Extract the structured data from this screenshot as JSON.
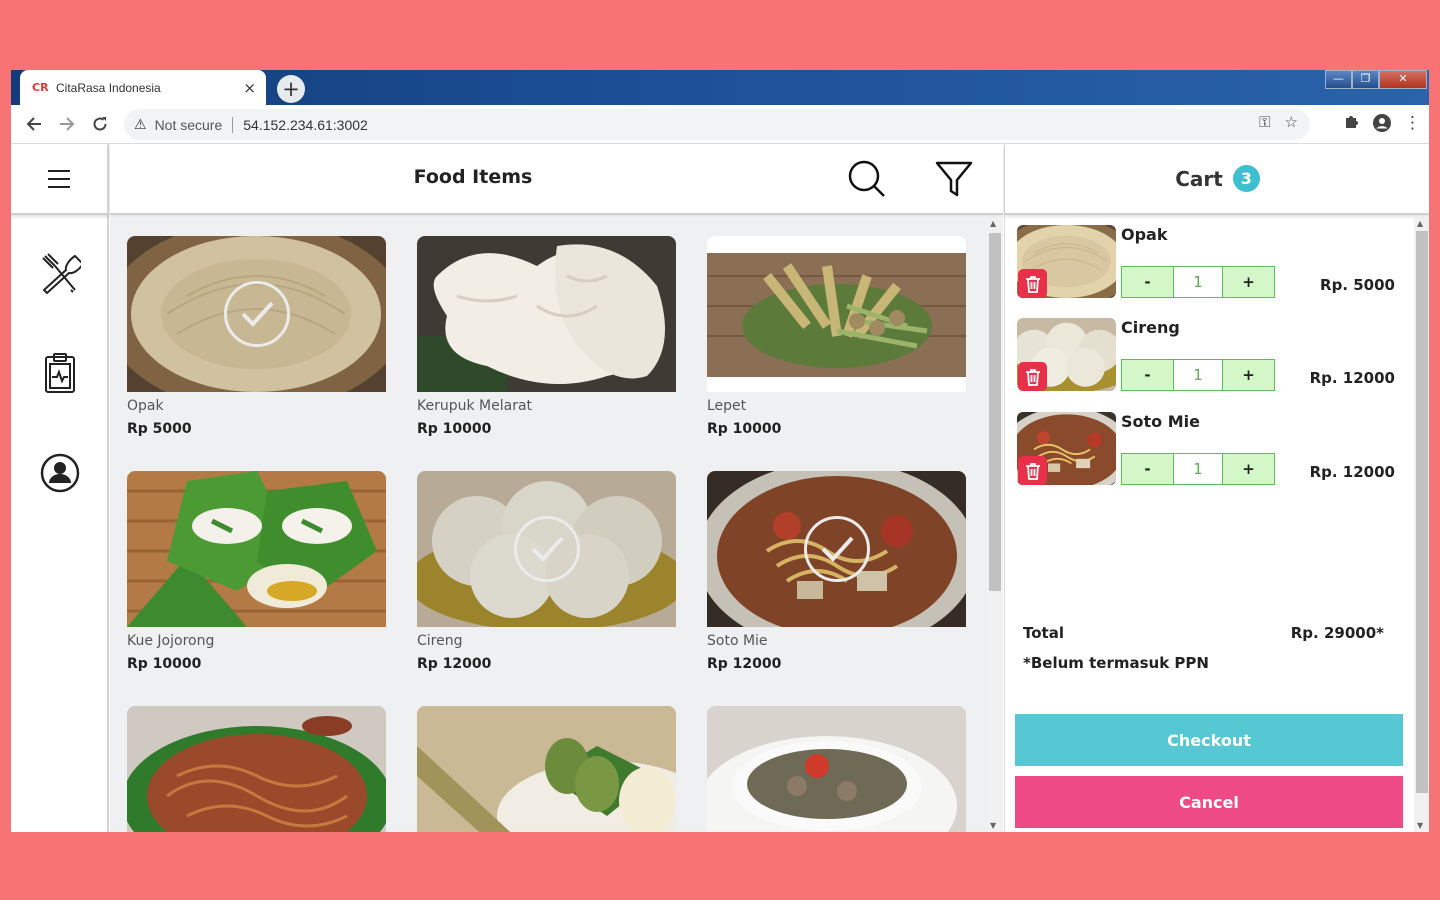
{
  "browser": {
    "tab_favicon": "CR",
    "tab_title": "CitaRasa Indonesia",
    "tab_close": "×",
    "new_tab": "+",
    "security_label": "Not secure",
    "url": "54.152.234.61:3002",
    "window_buttons": [
      "minimize",
      "restore",
      "close"
    ]
  },
  "header": {
    "title": "Food Items",
    "icons": [
      "menu-icon",
      "search-icon",
      "filter-icon"
    ]
  },
  "sidebar": {
    "items": [
      {
        "icon": "utensils-icon",
        "name": "menu"
      },
      {
        "icon": "clipboard-icon",
        "name": "orders"
      },
      {
        "icon": "user-icon",
        "name": "profile"
      }
    ]
  },
  "foods": [
    {
      "name": "Opak",
      "price": "Rp 5000",
      "selected": true,
      "image": "opak"
    },
    {
      "name": "Kerupuk Melarat",
      "price": "Rp 10000",
      "selected": false,
      "image": "kerupuk"
    },
    {
      "name": "Lepet",
      "price": "Rp 10000",
      "selected": false,
      "image": "lepet"
    },
    {
      "name": "Kue Jojorong",
      "price": "Rp 10000",
      "selected": false,
      "image": "jojorong"
    },
    {
      "name": "Cireng",
      "price": "Rp 12000",
      "selected": true,
      "image": "cireng"
    },
    {
      "name": "Soto Mie",
      "price": "Rp 12000",
      "selected": true,
      "image": "sotomie"
    },
    {
      "name": "",
      "price": "",
      "selected": false,
      "image": "noodle-salad"
    },
    {
      "name": "",
      "price": "",
      "selected": false,
      "image": "lontong"
    },
    {
      "name": "",
      "price": "",
      "selected": false,
      "image": "soup"
    }
  ],
  "cart": {
    "title": "Cart",
    "count": "3",
    "items": [
      {
        "name": "Opak",
        "qty": "1",
        "price": "Rp. 5000",
        "minus": "-",
        "plus": "+"
      },
      {
        "name": "Cireng",
        "qty": "1",
        "price": "Rp. 12000",
        "minus": "-",
        "plus": "+"
      },
      {
        "name": "Soto Mie",
        "qty": "1",
        "price": "Rp. 12000",
        "minus": "-",
        "plus": "+"
      }
    ],
    "total_label": "Total",
    "total_value": "Rp. 29000*",
    "note": "*Belum termasuk PPN",
    "checkout_label": "Checkout",
    "cancel_label": "Cancel"
  },
  "colors": {
    "background": "#f87373",
    "accent_teal": "#55c8d3",
    "cancel_pink": "#ee4a86",
    "qty_green": "#d4f7c8",
    "badge": "#3dbfd0",
    "trash_red": "#e8304a"
  }
}
